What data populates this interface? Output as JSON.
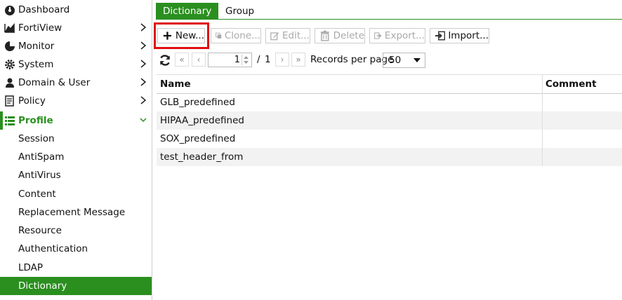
{
  "sidebar": {
    "items": [
      {
        "label": "Dashboard",
        "icon": "dashboard-icon"
      },
      {
        "label": "FortiView",
        "icon": "fortiview-icon"
      },
      {
        "label": "Monitor",
        "icon": "monitor-icon"
      },
      {
        "label": "System",
        "icon": "gear-icon"
      },
      {
        "label": "Domain & User",
        "icon": "user-icon"
      },
      {
        "label": "Policy",
        "icon": "policy-icon"
      },
      {
        "label": "Profile",
        "icon": "list-icon"
      }
    ],
    "subitems": [
      {
        "label": "Session"
      },
      {
        "label": "AntiSpam"
      },
      {
        "label": "AntiVirus"
      },
      {
        "label": "Content"
      },
      {
        "label": "Replacement Message"
      },
      {
        "label": "Resource"
      },
      {
        "label": "Authentication"
      },
      {
        "label": "LDAP"
      },
      {
        "label": "Dictionary"
      }
    ],
    "active_item": "Dictionary",
    "accent_color": "#2a8f1f"
  },
  "tabs": [
    {
      "label": "Dictionary",
      "active": true
    },
    {
      "label": "Group",
      "active": false
    }
  ],
  "toolbar": {
    "new_label": "New...",
    "clone_label": "Clone...",
    "edit_label": "Edit...",
    "delete_label": "Delete",
    "export_label": "Export...",
    "import_label": "Import...",
    "highlight_color": "#e01010"
  },
  "pager": {
    "current_page": "1",
    "separator": "/",
    "total_pages": "1",
    "records_label": "Records per page",
    "records_value": "50"
  },
  "table": {
    "columns": [
      "Name",
      "Comment"
    ],
    "rows": [
      {
        "name": "GLB_predefined",
        "comment": ""
      },
      {
        "name": "HIPAA_predefined",
        "comment": ""
      },
      {
        "name": "SOX_predefined",
        "comment": ""
      },
      {
        "name": "test_header_from",
        "comment": ""
      }
    ]
  }
}
